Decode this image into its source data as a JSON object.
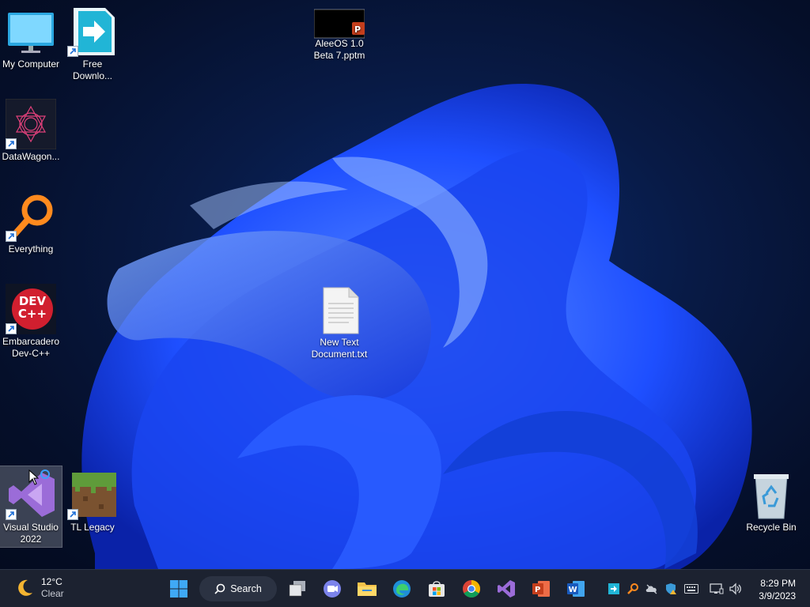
{
  "desktop": {
    "icons": [
      {
        "label": "My Computer"
      },
      {
        "label": "Free\nDownlo..."
      },
      {
        "label": "AleeOS 1.0\nBeta 7.pptm"
      },
      {
        "label": "DataWagon..."
      },
      {
        "label": "Everything"
      },
      {
        "label": "Embarcadero\nDev-C++"
      },
      {
        "label": "New Text\nDocument.txt"
      },
      {
        "label": "Visual Studio\n2022"
      },
      {
        "label": "TL Legacy"
      },
      {
        "label": "Recycle Bin"
      }
    ],
    "devcpp_logo": {
      "line1": "DEV",
      "line2": "C++"
    }
  },
  "taskbar": {
    "weather": {
      "temp": "12°C",
      "condition": "Clear"
    },
    "search_label": "Search",
    "clock": {
      "time": "8:29 PM",
      "date": "3/9/2023"
    }
  },
  "colors": {
    "taskbar_bg": "#1c2230",
    "accent": "#0078d4",
    "wallpaper_blue": "#1e4fff"
  }
}
